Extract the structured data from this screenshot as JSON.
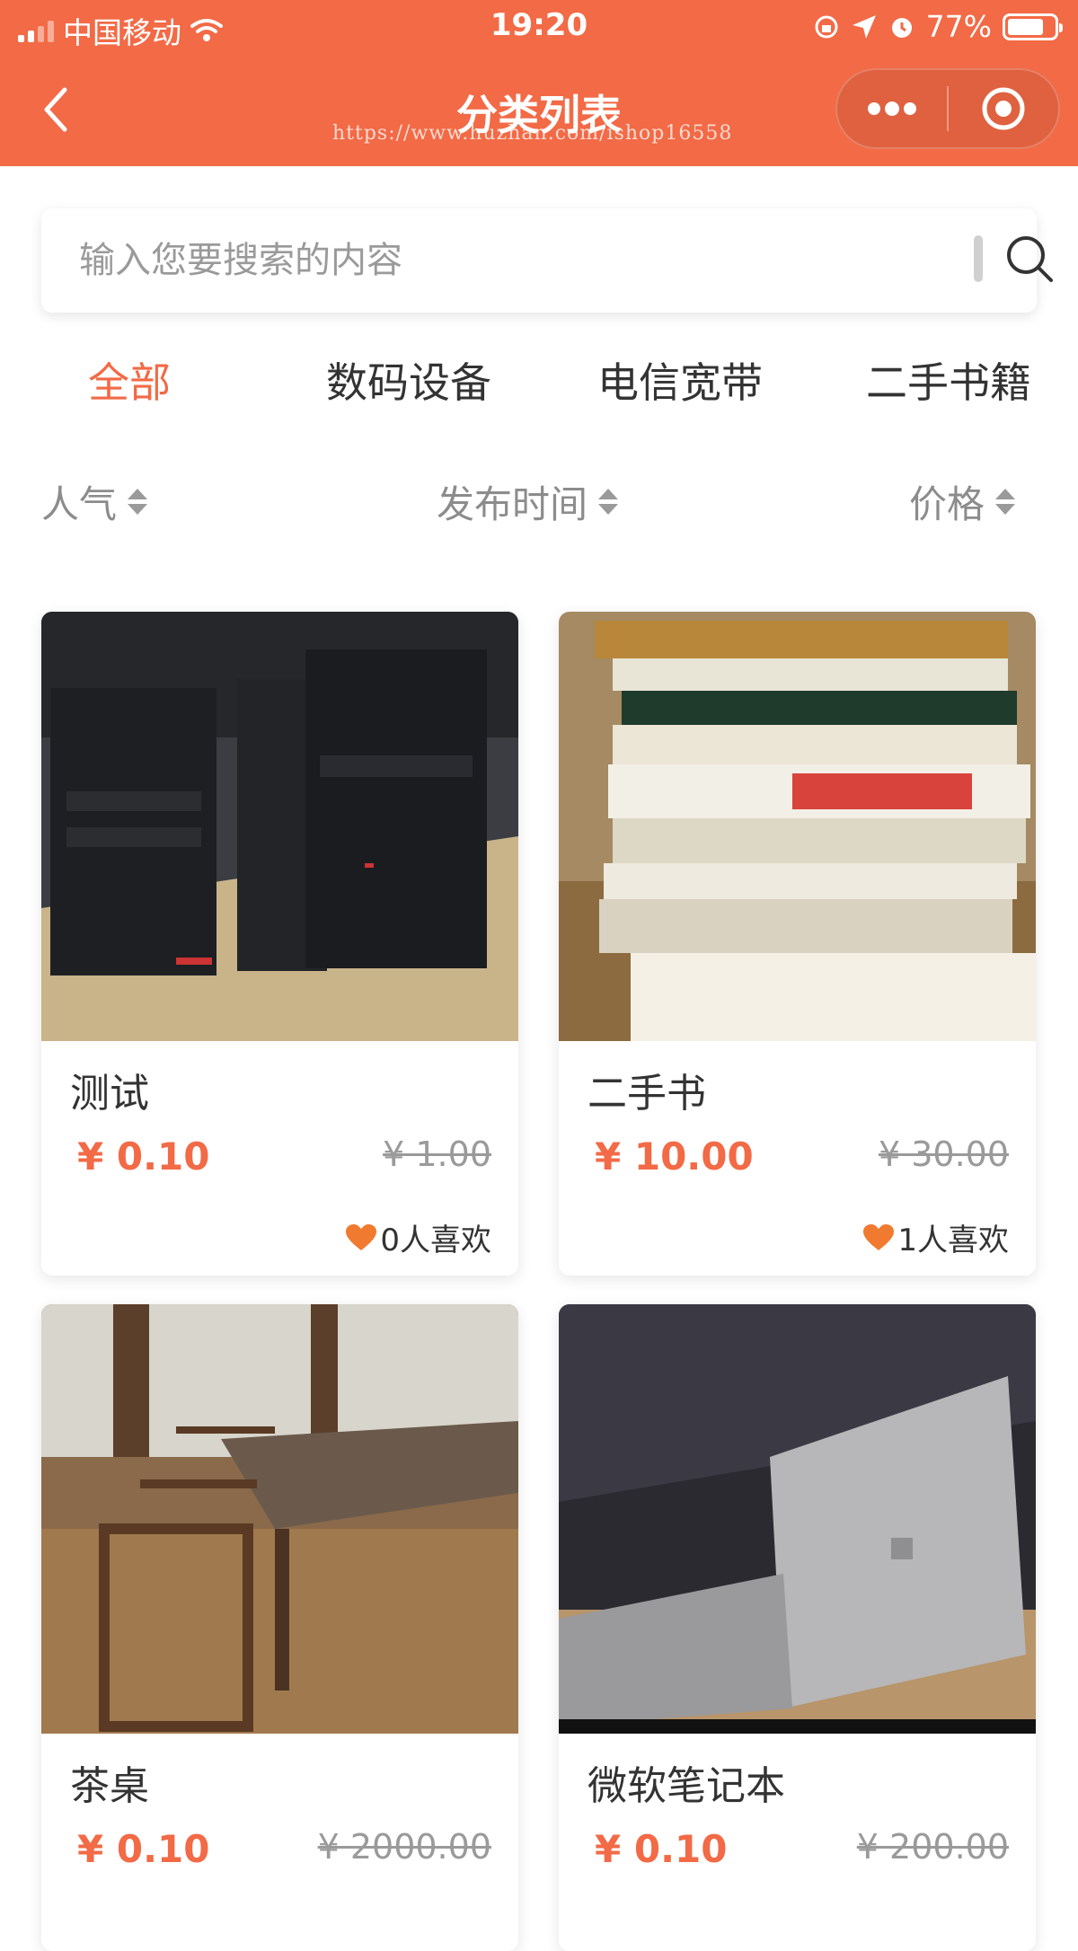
{
  "status_bar": {
    "carrier": "中国移动",
    "time": "19:20",
    "battery": "77%",
    "battery_level": 0.77
  },
  "nav": {
    "title": "分类列表",
    "watermark": "https://www.huzhan.com/ishop16558"
  },
  "search": {
    "placeholder": "输入您要搜索的内容",
    "value": ""
  },
  "tabs": [
    {
      "label": "全部",
      "active": true
    },
    {
      "label": "数码设备",
      "active": false
    },
    {
      "label": "电信宽带",
      "active": false
    },
    {
      "label": "二手书籍",
      "active": false
    }
  ],
  "sort": [
    {
      "label": "人气"
    },
    {
      "label": "发布时间"
    },
    {
      "label": "价格"
    }
  ],
  "products": [
    {
      "name": "测试",
      "price": "¥ 0.10",
      "original_price": "¥ 1.00",
      "likes": "0人喜欢",
      "image": "computer-towers-photo"
    },
    {
      "name": "二手书",
      "price": "¥ 10.00",
      "original_price": "¥ 30.00",
      "likes": "1人喜欢",
      "image": "book-stack-photo"
    },
    {
      "name": "茶桌",
      "price": "¥ 0.10",
      "original_price": "¥ 2000.00",
      "likes": "",
      "image": "tea-table-photo"
    },
    {
      "name": "微软笔记本",
      "price": "¥ 0.10",
      "original_price": "¥ 200.00",
      "likes": "",
      "image": "surface-laptop-photo"
    }
  ],
  "colors": {
    "accent": "#f26a46",
    "heart": "#f07a30",
    "muted": "#9a9a9a"
  }
}
